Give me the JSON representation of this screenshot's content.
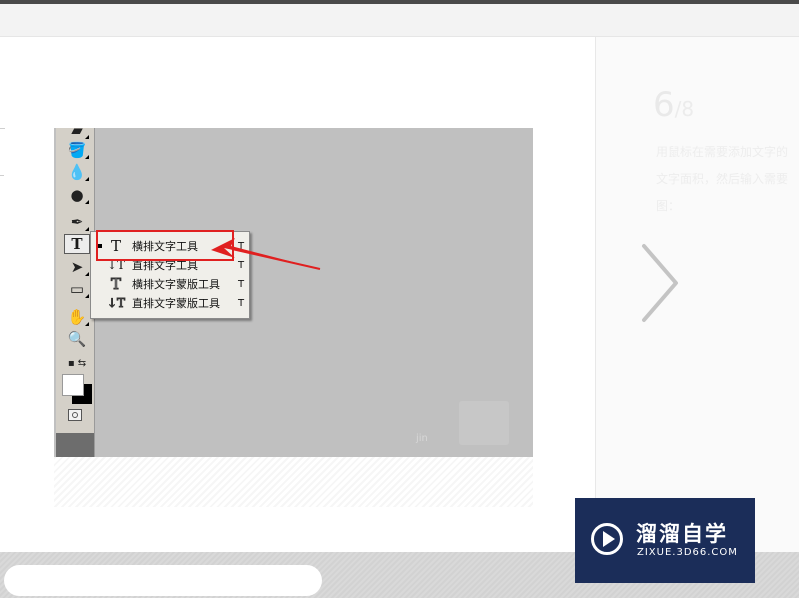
{
  "step": {
    "number": "6",
    "total": "/8",
    "description": "用鼠标在需要添加文字的\n文字面积，然后输入需要\n图："
  },
  "navigation": {
    "next_label": "›"
  },
  "screenshot": {
    "flyout_items": [
      {
        "icon": "T",
        "label": "横排文字工具",
        "shortcut": "T"
      },
      {
        "icon": "↓T",
        "label": "直排文字工具",
        "shortcut": "T"
      },
      {
        "icon": "T",
        "label": "横排文字蒙版工具",
        "shortcut": "T"
      },
      {
        "icon": "↓T",
        "label": "直排文字蒙版工具",
        "shortcut": "T"
      }
    ],
    "active_tool_glyph": "T",
    "watermark": "jin"
  },
  "comment": {
    "placeholder": ""
  },
  "brand": {
    "name": "溜溜自学",
    "url": "ZIXUE.3D66.COM"
  },
  "colors": {
    "highlight": "#e02020",
    "brand_bg": "#1b2d59"
  }
}
